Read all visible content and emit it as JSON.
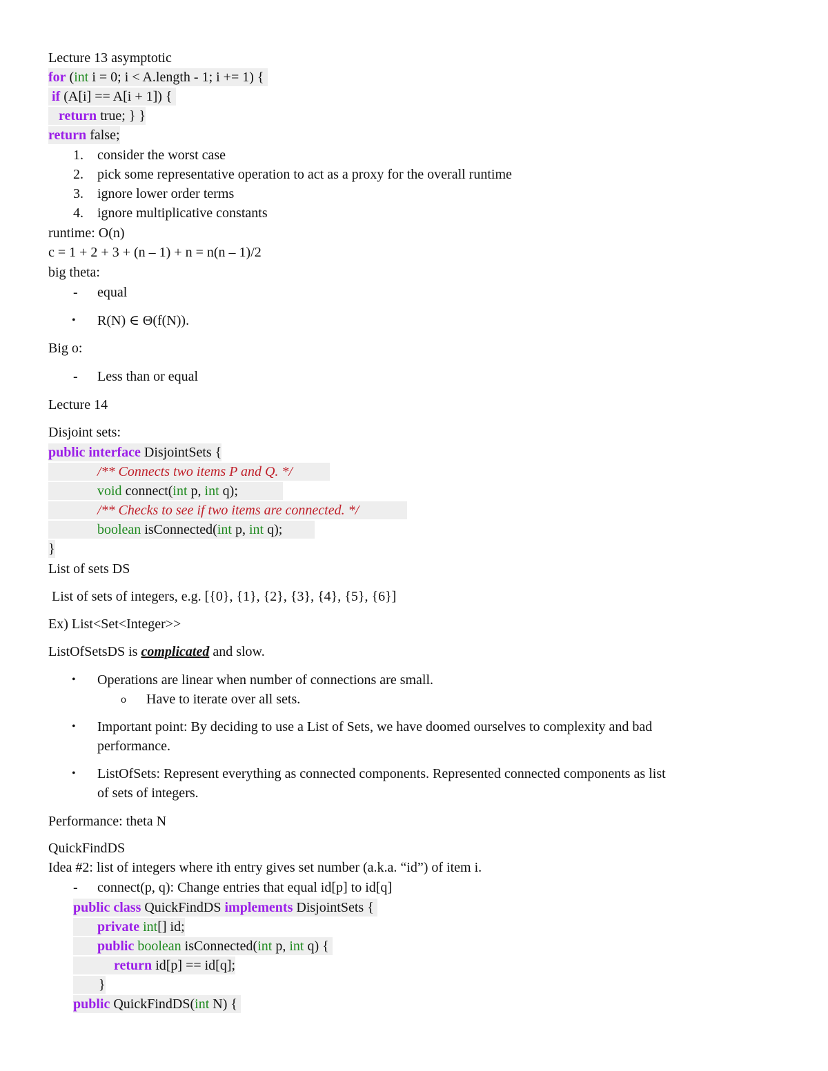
{
  "lecture13": {
    "title": "Lecture 13 asymptotic",
    "code": {
      "l1_kw": "for",
      "l1_a": " (",
      "l1_ty": "int",
      "l1_b": " i = 0; i < A.length - 1; i += 1) {",
      "l2_kw": "if",
      "l2_a": " (A[i] == A[i + 1]) {",
      "l3_kw": "return",
      "l3_a": " true; } }",
      "l4_kw": "return",
      "l4_a": " false;"
    },
    "steps": [
      {
        "num": "1.",
        "text": "consider the worst case"
      },
      {
        "num": "2.",
        "text": "pick some representative operation to act as a proxy for the overall runtime"
      },
      {
        "num": "3.",
        "text": "ignore lower order terms"
      },
      {
        "num": "4.",
        "text": "ignore multiplicative constants"
      }
    ],
    "runtime": "runtime: O(n)",
    "sum": "c = 1 + 2 + 3 + (n – 1) + n = n(n – 1)/2",
    "big_theta": "big theta:",
    "theta_items": [
      {
        "marker": "-",
        "text": "equal"
      },
      {
        "marker": "•",
        "text": "R(N) ∈ Θ(f(N))."
      }
    ],
    "big_o": "Big o:",
    "big_o_items": [
      {
        "marker": "-",
        "text": "Less than or equal"
      }
    ]
  },
  "lecture14": {
    "title": "Lecture 14",
    "disjoint": "Disjoint sets:",
    "iface": {
      "kw1": "public",
      "kw2": "interface",
      "name": " DisjointSets {",
      "c1": "/** Connects two items P and Q. */",
      "m1_ty": "void",
      "m1_a": " connect(",
      "m1_ty2": "int",
      "m1_b": " p, ",
      "m1_ty3": "int",
      "m1_c": " q);",
      "c2": "/** Checks to see if two items are connected. */",
      "m2_ty": "boolean",
      "m2_a": " isConnected(",
      "m2_ty2": "int",
      "m2_b": " p, ",
      "m2_ty3": "int",
      "m2_c": " q);",
      "close": "}"
    },
    "list_of_sets": "List of sets DS",
    "list_example": " List of sets of integers, e.g. [{0}, {1}, {2}, {3}, {4}, {5}, {6}]",
    "ex": "Ex) List<Set<Integer>>",
    "complicated_pre": "ListOfSetsDS is ",
    "complicated_word": "complicated",
    "complicated_post": " and slow.",
    "bullets": [
      {
        "text": "Operations are linear when number of connections are small."
      },
      {
        "text": "Have to iterate over all sets."
      },
      {
        "text": "Important point: By deciding to use a List of Sets, we have doomed ourselves to complexity and bad",
        "text2": "performance."
      },
      {
        "text": "ListOfSets: Represent everything as connected components. Represented connected components as list",
        "text2": "of sets of integers."
      }
    ],
    "sub_marker": "o",
    "bullet_marker": "•",
    "performance": "Performance: theta N",
    "quickfind": "QuickFindDS",
    "idea": "Idea #2: list of integers where ith entry gives set number (a.k.a. “id”) of item i.",
    "connect_marker": "-",
    "connect_desc": "connect(p, q): Change entries that equal id[p] to id[q]",
    "qf_code": {
      "l1_kw1": "public",
      "l1_kw2": "class",
      "l1_a": " QuickFindDS ",
      "l1_kw3": "implements",
      "l1_b": " DisjointSets {",
      "l2_kw": "private",
      "l2_ty": " int",
      "l2_a": "[] id;",
      "l3_kw": "public",
      "l3_ty": " boolean",
      "l3_a": " isConnected(",
      "l3_ty2": "int",
      "l3_b": " p, ",
      "l3_ty3": "int",
      "l3_c": " q) {",
      "l4_kw": "return",
      "l4_a": " id[p] == id[q];",
      "l5_a": "}",
      "l6_kw": "public",
      "l6_a": " QuickFindDS(",
      "l6_ty": "int",
      "l6_b": " N) {"
    }
  }
}
